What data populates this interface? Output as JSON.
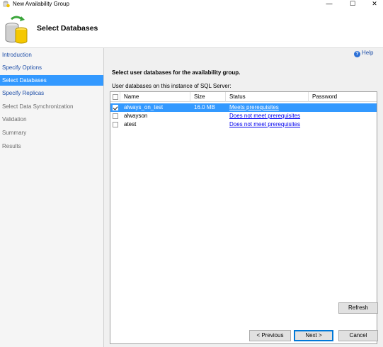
{
  "window": {
    "title": "New Availability Group",
    "minimize_glyph": "—",
    "maximize_glyph": "☐",
    "close_glyph": "✕"
  },
  "header": {
    "title": "Select Databases"
  },
  "nav": {
    "items": [
      {
        "label": "Introduction",
        "state": "link"
      },
      {
        "label": "Specify Options",
        "state": "link"
      },
      {
        "label": "Select Databases",
        "state": "active"
      },
      {
        "label": "Specify Replicas",
        "state": "link"
      },
      {
        "label": "Select Data Synchronization",
        "state": "disabled"
      },
      {
        "label": "Validation",
        "state": "disabled"
      },
      {
        "label": "Summary",
        "state": "disabled"
      },
      {
        "label": "Results",
        "state": "disabled"
      }
    ]
  },
  "main": {
    "help_label": "Help",
    "instruction": "Select user databases for the availability group.",
    "subheading": "User databases on this instance of SQL Server:"
  },
  "grid": {
    "columns": [
      "Name",
      "Size",
      "Status",
      "Password"
    ],
    "rows": [
      {
        "checked": true,
        "name": "always_on_test",
        "size": "16.0 MB",
        "status": "Meets prerequisites",
        "password": ""
      },
      {
        "checked": false,
        "name": "alwayson",
        "size": "",
        "status": "Does not meet prerequisites",
        "password": ""
      },
      {
        "checked": false,
        "name": "atest",
        "size": "",
        "status": "Does not meet prerequisites",
        "password": ""
      }
    ]
  },
  "buttons": {
    "refresh": "Refresh",
    "previous": "< Previous",
    "next": "Next >",
    "cancel": "Cancel"
  },
  "colors": {
    "selection": "#3399ff",
    "link": "#1f4fa8",
    "accent": "#0078d7"
  }
}
